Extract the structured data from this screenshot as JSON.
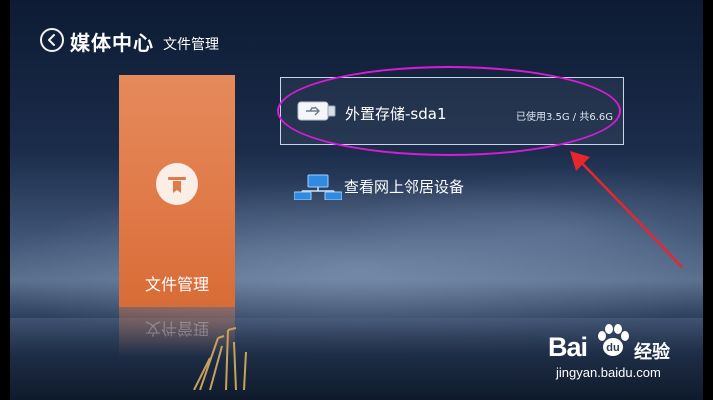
{
  "header": {
    "title": "媒体中心",
    "subtitle": "文件管理"
  },
  "tile": {
    "label": "文件管理",
    "icon": "file-manager-icon",
    "color": "#e07a48"
  },
  "list": {
    "storage": {
      "name": "外置存储-sda1",
      "usage": "已使用3.5G / 共6.6G",
      "icon": "usb-drive-icon"
    },
    "network": {
      "label": "查看网上邻居设备",
      "icon": "network-computers-icon"
    }
  },
  "annotation": {
    "highlight_color": "#d81bd8",
    "arrow_color": "#e8262d"
  },
  "watermark": {
    "logo_left": "Bai",
    "logo_right": "经验",
    "url": "jingyan.baidu.com"
  }
}
